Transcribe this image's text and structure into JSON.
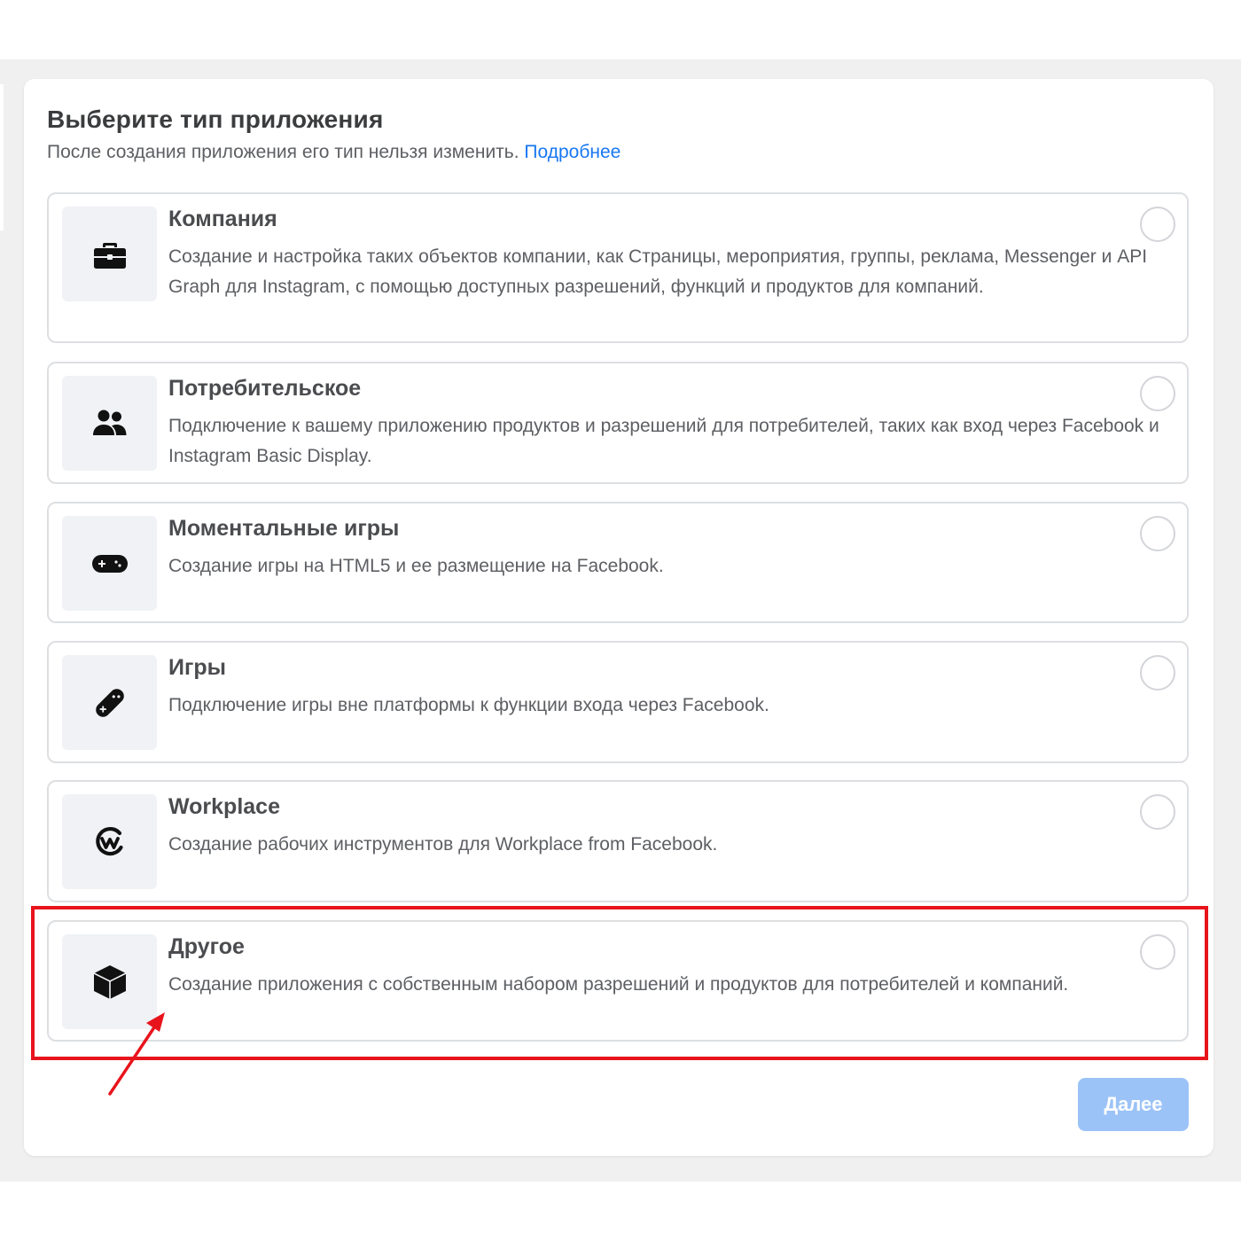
{
  "dialog": {
    "title": "Выберите тип приложения",
    "subtitle": "После создания приложения его тип нельзя изменить.",
    "learn_more": "Подробнее",
    "next_button": "Далее"
  },
  "options": [
    {
      "title": "Компания",
      "description": "Создание и настройка таких объектов компании, как Страницы, мероприятия, группы, реклама, Messenger и API Graph для Instagram, с помощью доступных разрешений, функций и продуктов для компаний.",
      "icon": "briefcase-icon",
      "selected": false
    },
    {
      "title": "Потребительское",
      "description": "Подключение к вашему приложению продуктов и разрешений для потребителей, таких как вход через Facebook и Instagram Basic Display.",
      "icon": "people-icon",
      "selected": false
    },
    {
      "title": "Моментальные игры",
      "description": "Создание игры на HTML5 и ее размещение на Facebook.",
      "icon": "gamepad-icon",
      "selected": false
    },
    {
      "title": "Игры",
      "description": "Подключение игры вне платформы к функции входа через Facebook.",
      "icon": "game-controller-icon",
      "selected": false
    },
    {
      "title": "Workplace",
      "description": "Создание рабочих инструментов для Workplace from Facebook.",
      "icon": "workplace-icon",
      "selected": false
    },
    {
      "title": "Другое",
      "description": "Создание приложения с собственным набором разрешений и продуктов для потребителей и компаний.",
      "icon": "cube-icon",
      "selected": false
    }
  ],
  "annotation": {
    "highlight_color": "#e8141c"
  }
}
